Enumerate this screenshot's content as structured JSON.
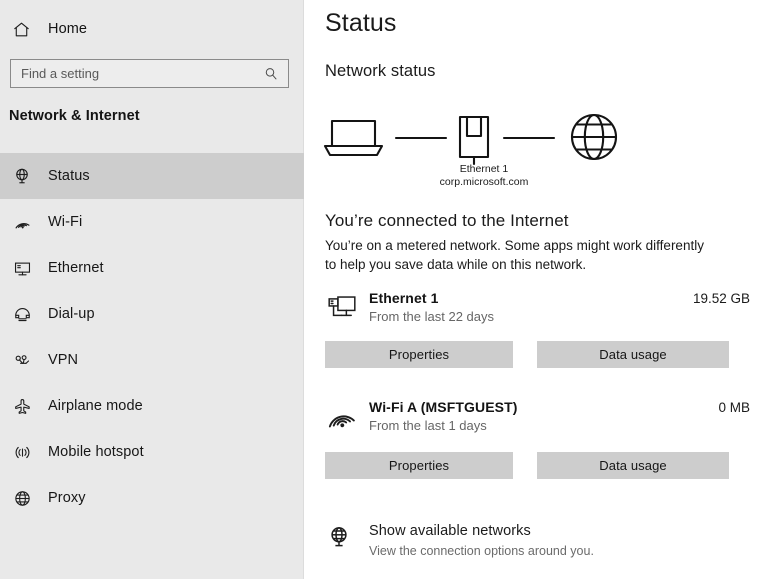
{
  "sidebar": {
    "home": {
      "label": "Home",
      "icon": "home-icon"
    },
    "search": {
      "value": "",
      "placeholder": "Find a setting",
      "icon": "search-icon"
    },
    "section_heading": "Network & Internet",
    "items": [
      {
        "label": "Status",
        "icon": "globe-stand-icon",
        "selected": true
      },
      {
        "label": "Wi-Fi",
        "icon": "wifi-icon",
        "selected": false
      },
      {
        "label": "Ethernet",
        "icon": "monitor-icon",
        "selected": false
      },
      {
        "label": "Dial-up",
        "icon": "dialup-phone-icon",
        "selected": false
      },
      {
        "label": "VPN",
        "icon": "vpn-key-icon",
        "selected": false
      },
      {
        "label": "Airplane mode",
        "icon": "airplane-icon",
        "selected": false
      },
      {
        "label": "Mobile hotspot",
        "icon": "broadcast-icon",
        "selected": false
      },
      {
        "label": "Proxy",
        "icon": "globe-icon",
        "selected": false
      }
    ]
  },
  "main": {
    "page_title": "Status",
    "sub_title": "Network status",
    "diagram": {
      "device_icon": "laptop-icon",
      "adapter_icon": "ethernet-port-icon",
      "internet_icon": "globe-icon",
      "caption_line1": "Ethernet 1",
      "caption_line2": "corp.microsoft.com"
    },
    "connected": {
      "title": "You’re connected to the Internet",
      "description": "You’re on a metered network. Some apps might work differently to help you save data while on this network."
    },
    "adapters": [
      {
        "name": "Ethernet 1",
        "sub": "From the last 22 days",
        "value": "19.52 GB",
        "icon": "monitor-network-icon",
        "properties_label": "Properties",
        "data_usage_label": "Data usage"
      },
      {
        "name": "Wi-Fi A (MSFTGUEST)",
        "sub": "From the last 1 days",
        "value": "0 MB",
        "icon": "wifi-icon",
        "properties_label": "Properties",
        "data_usage_label": "Data usage"
      }
    ],
    "show_networks": {
      "title": "Show available networks",
      "subtitle": "View the connection options around you.",
      "icon": "globe-stand-icon"
    }
  },
  "colors": {
    "sidebar_bg": "#e9e9e9",
    "selected_bg": "#cdcdcd",
    "button_bg": "#cdcdcd",
    "content_bg": "#ffffff",
    "text": "#1b1b1b",
    "muted_text": "#666666"
  }
}
